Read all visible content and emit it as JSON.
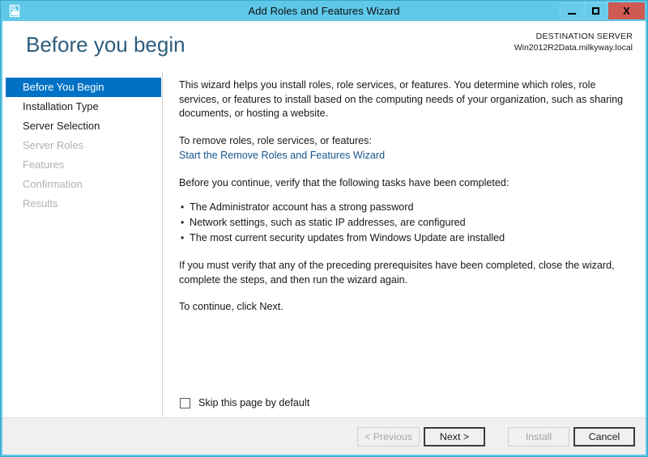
{
  "window": {
    "title": "Add Roles and Features Wizard",
    "app_icon": "server-features-icon",
    "controls": {
      "minimize": "minimize-icon",
      "maximize": "maximize-icon",
      "close_label": "X"
    },
    "accent_color": "#5fc8e8",
    "selection_color": "#0072c6",
    "link_color": "#19558c"
  },
  "header": {
    "page_title": "Before you begin",
    "destination_label": "DESTINATION SERVER",
    "destination_value": "Win2012R2Data.milkyway.local"
  },
  "nav": {
    "items": [
      {
        "label": "Before You Begin",
        "state": "selected"
      },
      {
        "label": "Installation Type",
        "state": "enabled"
      },
      {
        "label": "Server Selection",
        "state": "enabled"
      },
      {
        "label": "Server Roles",
        "state": "disabled"
      },
      {
        "label": "Features",
        "state": "disabled"
      },
      {
        "label": "Confirmation",
        "state": "disabled"
      },
      {
        "label": "Results",
        "state": "disabled"
      }
    ]
  },
  "content": {
    "intro_paragraph": "This wizard helps you install roles, role services, or features. You determine which roles, role services, or features to install based on the computing needs of your organization, such as sharing documents, or hosting a website.",
    "remove_prompt": "To remove roles, role services, or features:",
    "remove_link": "Start the Remove Roles and Features Wizard",
    "verify_heading": "Before you continue, verify that the following tasks have been completed:",
    "tasks": [
      "The Administrator account has a strong password",
      "Network settings, such as static IP addresses, are configured",
      "The most current security updates from Windows Update are installed"
    ],
    "prerequisite_note": "If you must verify that any of the preceding prerequisites have been completed, close the wizard, complete the steps, and then run the wizard again.",
    "continue_note": "To continue, click Next.",
    "skip_checkbox_label": "Skip this page by default",
    "skip_checkbox_checked": false
  },
  "footer": {
    "previous_label": "< Previous",
    "previous_enabled": false,
    "next_label": "Next >",
    "next_enabled": true,
    "install_label": "Install",
    "install_enabled": false,
    "cancel_label": "Cancel",
    "cancel_enabled": true
  }
}
